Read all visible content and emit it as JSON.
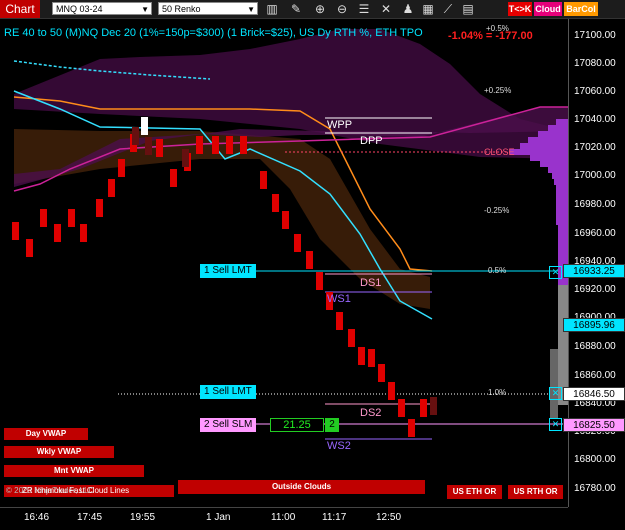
{
  "toolbar": {
    "tab_label": "Chart",
    "instrument": "MNQ 03-24",
    "bar_type": "50 Renko",
    "icons": [
      "bar-style-icon",
      "draw-tools-icon",
      "zoom-in-icon",
      "zoom-out-icon",
      "properties-icon",
      "trade-icon",
      "strategy-icon",
      "data-box-icon",
      "indicators-icon",
      "templates-icon"
    ],
    "btn_tk": "T<>K",
    "btn_cloud": "Cloud",
    "btn_barcol": "BarCol",
    "colors": {
      "tab": "#c00000",
      "tk": "#e60000",
      "cloud": "#e6007a",
      "barcol": "#ff9900"
    }
  },
  "chart": {
    "title": "RE 40 to 50 (M)NQ Dec 20 (1%=150p=$300) (1 Brick=$25), US Dy RTH %, ETH TPO",
    "pnl": "-1.04% = -177.00",
    "pct_top": "+0.5%",
    "pct_levels": [
      {
        "label": "+0.25%",
        "price": 17090
      },
      {
        "label": "-0.25%",
        "price": 16985
      },
      {
        "label": "0.5%",
        "price": 16933
      },
      {
        "label": "1.0%",
        "price": 16849
      }
    ],
    "level_labels": [
      {
        "label": "WPP",
        "price": 17041,
        "color": "#ffffff"
      },
      {
        "label": "DPP",
        "price": 17025,
        "color": "#ffffff"
      },
      {
        "label": "CLOSE",
        "price": 17016,
        "color": "#ff5555"
      },
      {
        "label": "DS1",
        "price": 16925,
        "color": "#ff99cc"
      },
      {
        "label": "WS1",
        "price": 16910,
        "color": "#9966ff"
      },
      {
        "label": "DS2",
        "price": 16838,
        "color": "#ff99cc"
      },
      {
        "label": "WS2",
        "price": 16815,
        "color": "#9966ff"
      }
    ],
    "orders": [
      {
        "label": "1 Sell LMT",
        "price": 16933.25
      },
      {
        "label": "1 Sell LMT",
        "price": 16846.5
      },
      {
        "label": "2 Sell SLM",
        "price": 16825.5,
        "value": "21.25",
        "qty": "2"
      }
    ],
    "buttons_left": [
      "Day VWAP",
      "Wkly VWAP",
      "Mnt VWAP"
    ],
    "button_outside": "Outside Clouds",
    "button_us_eth": "US ETH OR",
    "button_us_rth": "US RTH OR",
    "copyright": "© 2023 NinjaTrader, LLC",
    "overlay_text": "ZR Ichimoku Fast Cloud Lines"
  },
  "price_axis": {
    "ticks": [
      "17100.00",
      "17080.00",
      "17060.00",
      "17040.00",
      "17020.00",
      "17000.00",
      "16980.00",
      "16960.00",
      "16940.00",
      "16920.00",
      "16900.00",
      "16880.00",
      "16860.00",
      "16840.00",
      "16820.00",
      "16800.00",
      "16780.00"
    ],
    "current_prices": [
      {
        "value": "16933.25",
        "color": "#00e5ff"
      },
      {
        "value": "16895.96",
        "color": "#00e5ff"
      },
      {
        "value": "16846.50",
        "color": "#ffffff"
      },
      {
        "value": "16825.50",
        "color": "#ff99ff"
      }
    ]
  },
  "time_axis": {
    "ticks": [
      "16:46",
      "17:45",
      "19:55",
      "1 Jan",
      "11:00",
      "11:17",
      "12:50"
    ]
  }
}
